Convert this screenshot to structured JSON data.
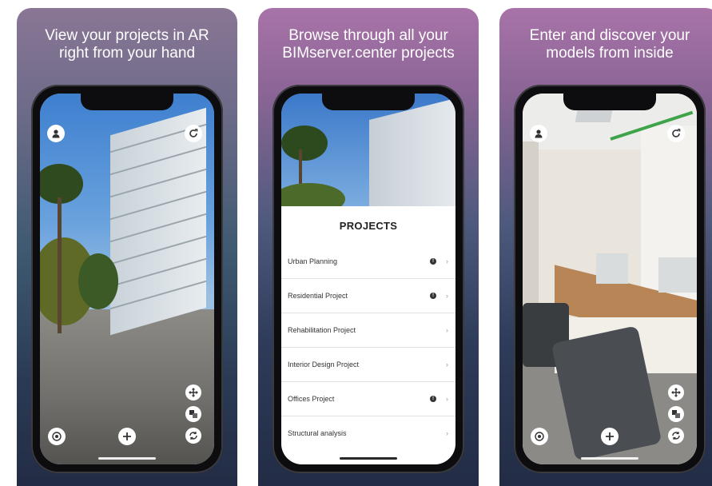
{
  "panels": [
    {
      "caption_line1": "View your projects in AR",
      "caption_line2": "right from your hand"
    },
    {
      "caption_line1": "Browse through all your",
      "caption_line2": "BIMserver.center projects"
    },
    {
      "caption_line1": "Enter and discover your",
      "caption_line2": "models from inside"
    }
  ],
  "projects": {
    "title": "PROJECTS",
    "items": [
      {
        "label": "Urban Planning",
        "has_badge": true,
        "badge": "!"
      },
      {
        "label": "Residential Project",
        "has_badge": true,
        "badge": "!"
      },
      {
        "label": "Rehabilitation Project",
        "has_badge": false
      },
      {
        "label": "Interior Design Project",
        "has_badge": false
      },
      {
        "label": "Offices Project",
        "has_badge": true,
        "badge": "!"
      },
      {
        "label": "Structural analysis",
        "has_badge": false
      }
    ],
    "chevron": "›"
  },
  "icons": {
    "profile": "user-icon",
    "refresh": "refresh-icon",
    "move": "move-icon",
    "layers": "layers-icon",
    "rotate": "rotate-icon",
    "add": "plus-icon",
    "target": "target-icon"
  },
  "colors": {
    "list_bg": "#ffffff",
    "button_bg": "#ffffff"
  }
}
